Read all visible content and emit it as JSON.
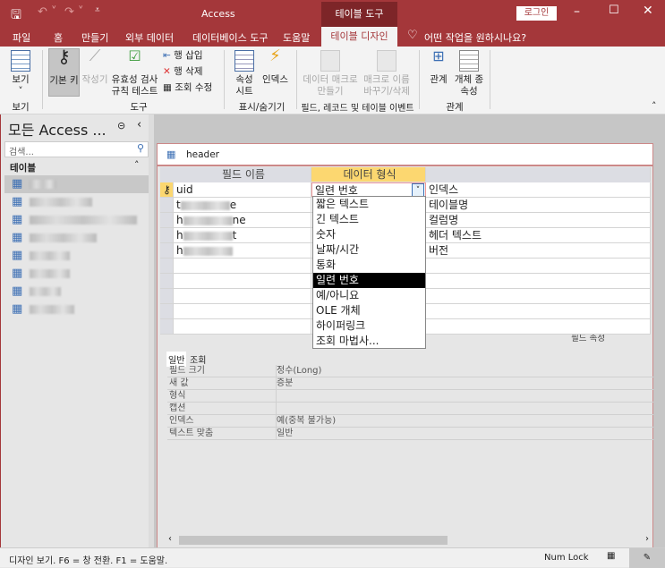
{
  "titlebar": {
    "app": "Access",
    "context_tab": "테이블 도구",
    "login": "로그인"
  },
  "tabs": [
    "파일",
    "홈",
    "만들기",
    "외부 데이터",
    "데이터베이스 도구",
    "도움말",
    "테이블 디자인"
  ],
  "tell_me": "어떤 작업을 원하시나요?",
  "ribbon": {
    "view": "보기",
    "view_group": "보기",
    "primary_key": "기본 키",
    "builder": "작성기",
    "validation": "유효성 검사 규칙 테스트",
    "insert_row": "행 삽입",
    "delete_row": "행 삭제",
    "modify_lookup": "조회 수정",
    "tools_group": "도구",
    "property_sheet": "속성 시트",
    "indexes": "인덱스",
    "showhide_group": "표시/숨기기",
    "create_macro": "데이터 매크로 만들기",
    "rename_macro": "매크로 이름 바꾸기/삭제",
    "events_group": "필드, 레코드 및 테이블 이벤트",
    "relationships": "관계",
    "dependencies": "개체 종속성",
    "rel_group": "관계"
  },
  "nav": {
    "title": "모든 Access ...",
    "search_placeholder": "검색...",
    "section": "테이블",
    "item_count": 8
  },
  "doc": {
    "tab": "header",
    "col_field": "필드 이름",
    "col_type": "데이터 형식",
    "col_desc": "",
    "rows": [
      {
        "name": "uid",
        "type": "일련 번호",
        "desc": "인덱스",
        "key": true
      },
      {
        "name": "t",
        "suffix": "e",
        "desc": "테이블명"
      },
      {
        "name": "h",
        "suffix": "ne",
        "desc": "컬럼명"
      },
      {
        "name": "h",
        "suffix": "t",
        "desc": "헤더 텍스트"
      },
      {
        "name": "h",
        "suffix": "",
        "desc": "버전"
      }
    ],
    "dropdown": [
      "짧은 텍스트",
      "긴 텍스트",
      "숫자",
      "날짜/시간",
      "통화",
      "일련 번호",
      "예/아니요",
      "OLE 개체",
      "하이퍼링크",
      "조회 마법사..."
    ],
    "dropdown_selected": "일련 번호",
    "field_props_label": "필드 속성",
    "prop_tabs": [
      "일반",
      "조회"
    ],
    "props": [
      [
        "필드 크기",
        "정수(Long)"
      ],
      [
        "새 값",
        "증분"
      ],
      [
        "형식",
        ""
      ],
      [
        "캡션",
        ""
      ],
      [
        "인덱스",
        "예(중복 불가능)"
      ],
      [
        "텍스트 맞춤",
        "일반"
      ]
    ]
  },
  "status": {
    "text": "디자인 보기. F6 = 창 전환. F1 = 도움말.",
    "numlock": "Num Lock"
  }
}
